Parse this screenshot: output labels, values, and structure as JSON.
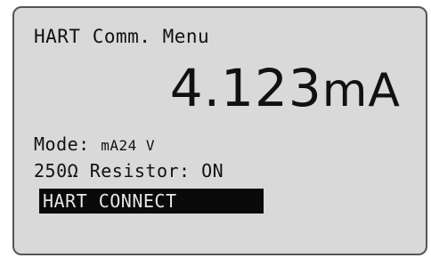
{
  "screen": {
    "title": "HART Comm. Menu",
    "reading": {
      "value": "4.123",
      "unit": "mA"
    },
    "mode": {
      "label": "Mode:",
      "measure": "mA",
      "source": "24 V"
    },
    "resistor": {
      "label": "250Ω Resistor:",
      "state": "ON"
    },
    "menu": {
      "selected_item": "HART CONNECT"
    }
  },
  "colors": {
    "lcd_background": "#d9d9d9",
    "text": "#111111",
    "highlight_background": "#0a0a0a",
    "highlight_text": "#e6e6e6"
  }
}
